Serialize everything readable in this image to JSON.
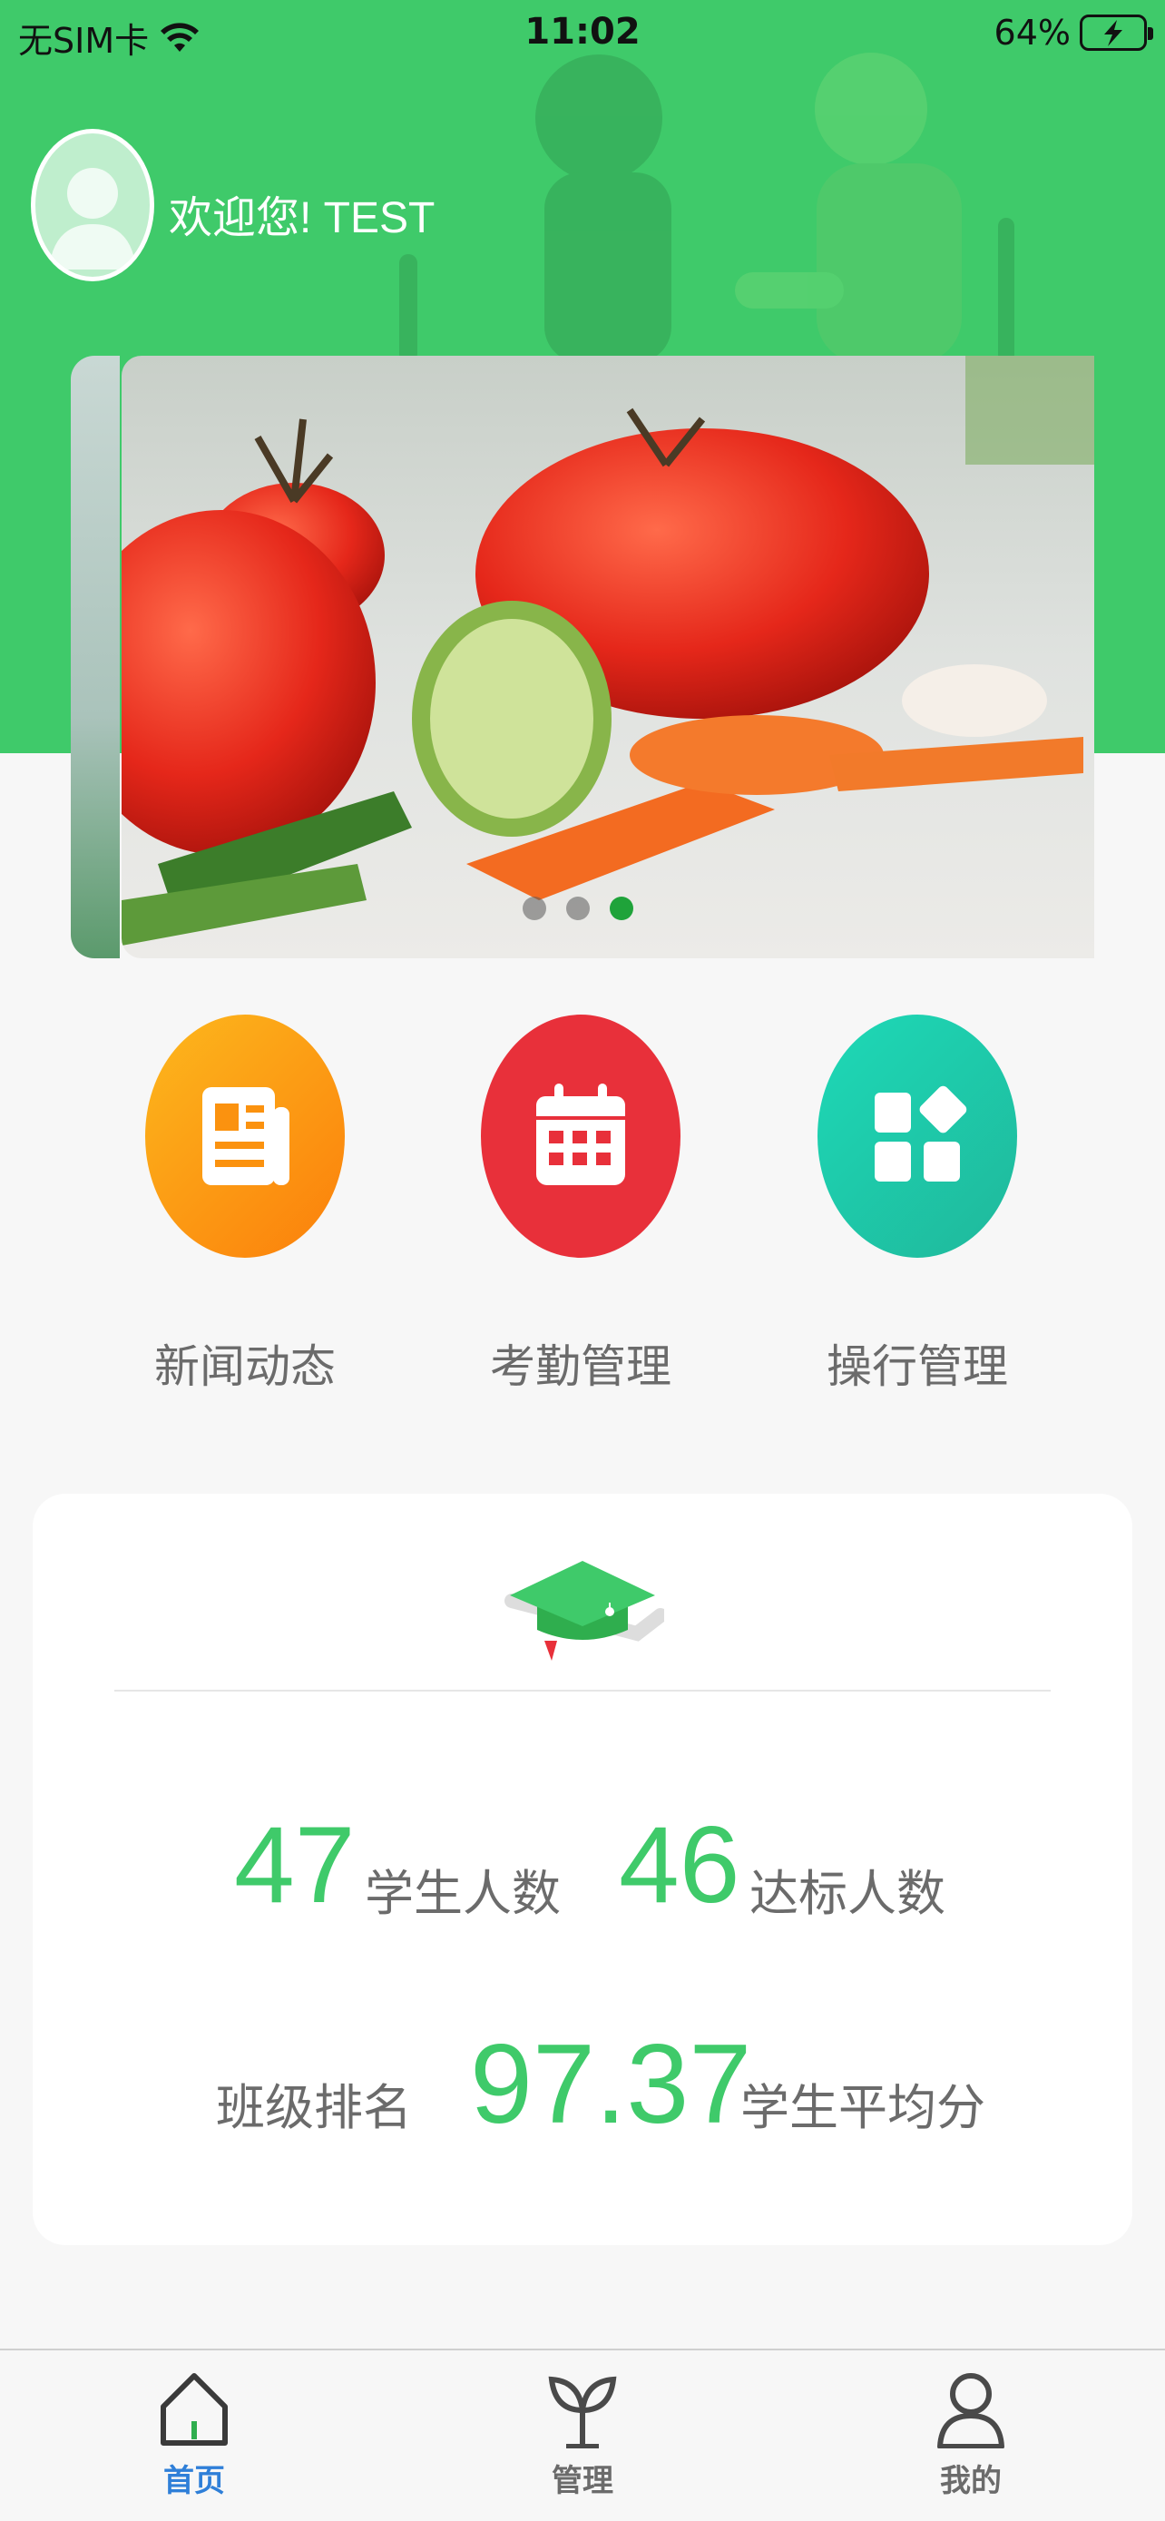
{
  "status_bar": {
    "carrier": "无SIM卡",
    "time": "11:02",
    "battery": "64%"
  },
  "header": {
    "welcome": "欢迎您! TEST"
  },
  "banner": {
    "slide_count": 3,
    "active_slide": 3
  },
  "quick_actions": [
    {
      "label": "新闻动态",
      "icon": "newspaper-icon",
      "color": "#fb8c0e"
    },
    {
      "label": "考勤管理",
      "icon": "calendar-icon",
      "color": "#e8303a"
    },
    {
      "label": "操行管理",
      "icon": "apps-grid-icon",
      "color": "#22c9a6"
    }
  ],
  "stats": {
    "student_count": "47",
    "student_count_label": "学生人数",
    "qualified_count": "46",
    "qualified_count_label": "达标人数",
    "class_rank_label": "班级排名",
    "average_score": "97.37",
    "average_score_label": "学生平均分"
  },
  "tabbar": {
    "home": "首页",
    "manage": "管理",
    "mine": "我的",
    "active": "home"
  },
  "colors": {
    "brand_green": "#3fca6a",
    "tab_active": "#2f7fd8"
  }
}
